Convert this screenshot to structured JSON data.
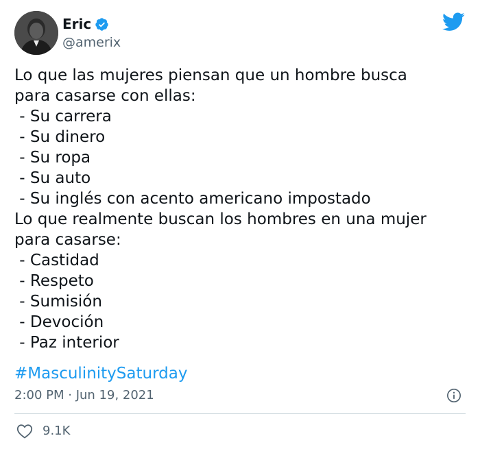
{
  "user": {
    "name": "Eric",
    "handle": "@amerix"
  },
  "tweet": {
    "lines": [
      "Lo que las mujeres piensan que un hombre busca",
      "para casarse con ellas:",
      " - Su carrera",
      " - Su dinero",
      " - Su ropa",
      " - Su auto",
      " - Su inglés con acento americano impostado",
      "Lo que realmente buscan los hombres en una mujer",
      "para casarse:",
      " - Castidad",
      " - Respeto",
      " - Sumisión",
      " - Devoción",
      " - Paz interior"
    ],
    "hashtag": "#MasculinitySaturday",
    "timestamp": "2:00 PM · Jun 19, 2021"
  },
  "engagement": {
    "likes": "9.1K"
  },
  "icons": {
    "verified": "verified-badge-icon",
    "brand": "twitter-bird-icon",
    "info": "info-icon",
    "like": "heart-icon"
  },
  "colors": {
    "accent": "#1d9bf0",
    "secondary_text": "#536471",
    "text": "#0f1419"
  }
}
